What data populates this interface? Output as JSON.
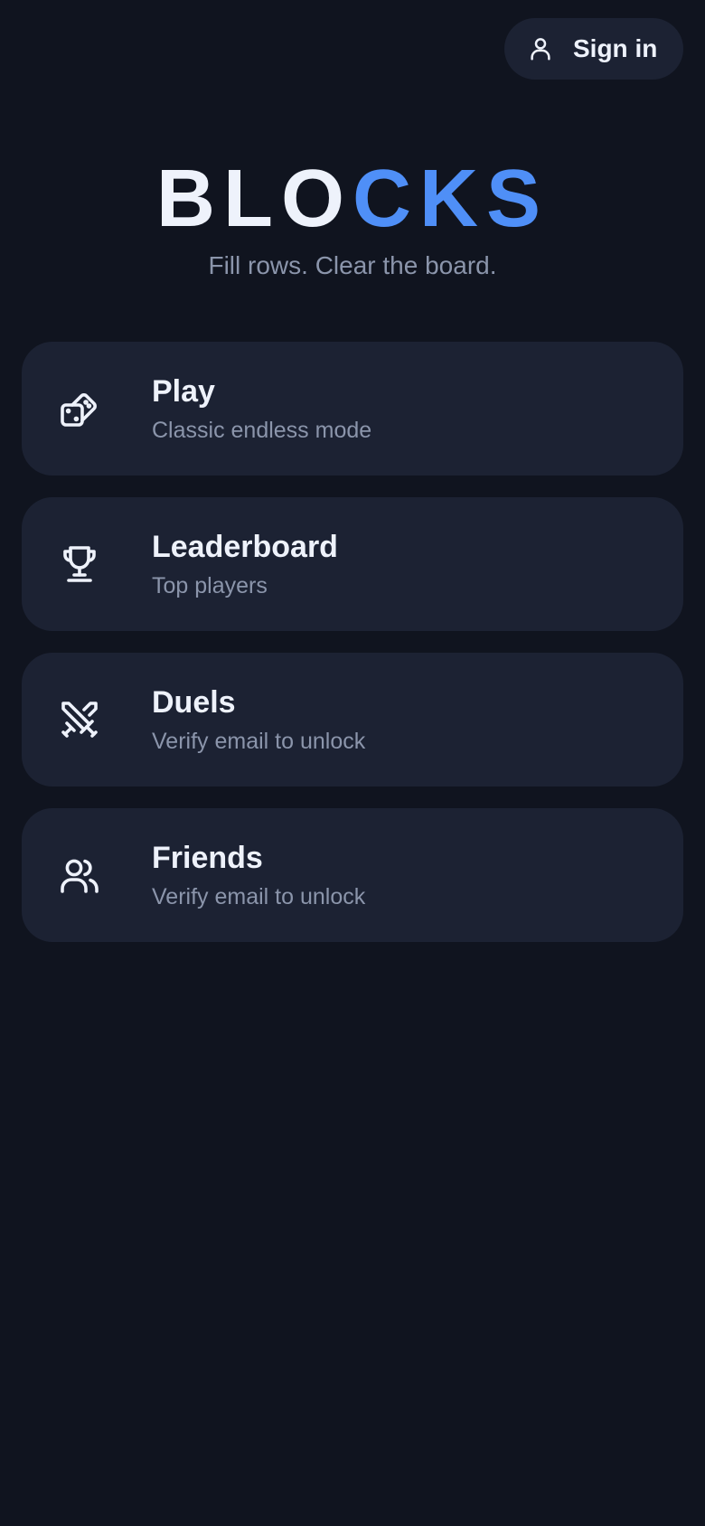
{
  "header": {
    "signin_label": "Sign in",
    "signin_icon": "user-icon"
  },
  "brand": {
    "part1": "BLO",
    "part2": "CKS",
    "part1_color": "#eef2fb",
    "part2_color": "#4f8ff7",
    "tagline": "Fill rows. Clear the board."
  },
  "menu": {
    "items": [
      {
        "title": "Play",
        "subtitle": "Classic endless mode",
        "icon": "dice-icon"
      },
      {
        "title": "Leaderboard",
        "subtitle": "Top players",
        "icon": "trophy-icon"
      },
      {
        "title": "Duels",
        "subtitle": "Verify email to unlock",
        "icon": "crossed-swords-icon"
      },
      {
        "title": "Friends",
        "subtitle": "Verify email to unlock",
        "icon": "users-icon"
      }
    ]
  },
  "colors": {
    "background": "#10141f",
    "card": "#1c2233",
    "text_primary": "#eef2fb",
    "text_secondary": "#8b95ab",
    "accent": "#4f8ff7"
  }
}
